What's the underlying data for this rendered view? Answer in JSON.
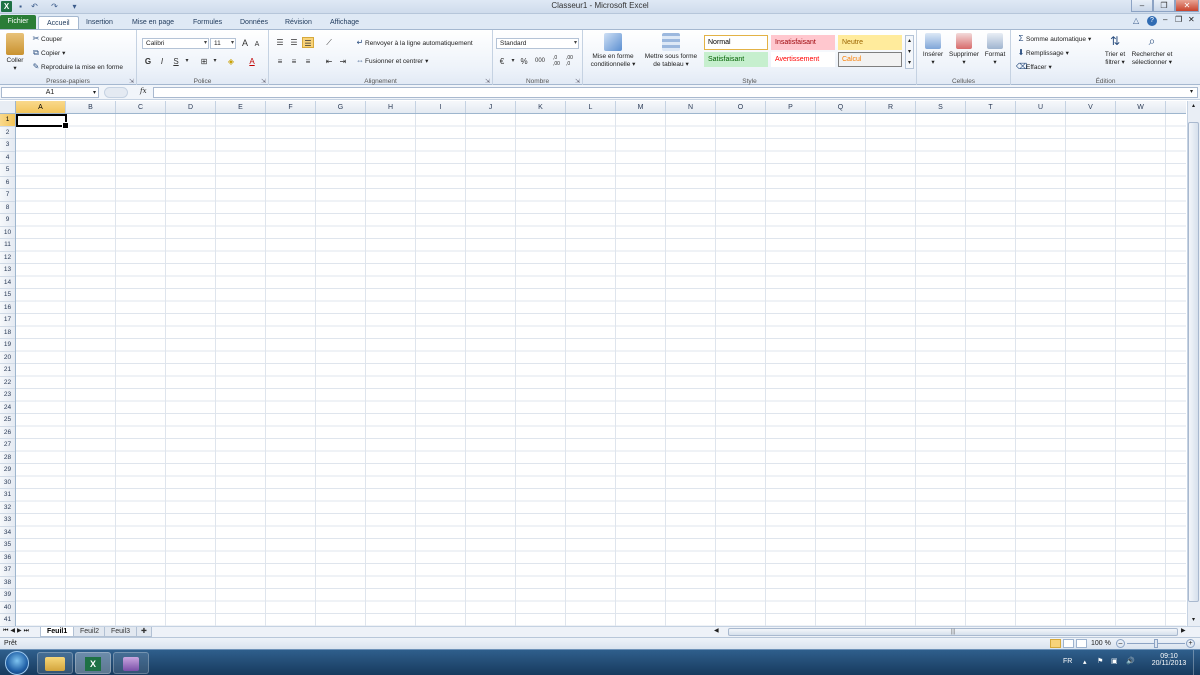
{
  "window": {
    "title": "Classeur1 - Microsoft Excel"
  },
  "quick_access": [
    "excel-logo-icon",
    "save-icon",
    "undo-icon",
    "redo-icon",
    "customize-icon"
  ],
  "tabs": {
    "file": "Fichier",
    "items": [
      "Accueil",
      "Insertion",
      "Mise en page",
      "Formules",
      "Données",
      "Révision",
      "Affichage"
    ],
    "active": "Accueil"
  },
  "ribbon": {
    "clipboard": {
      "label": "Presse-papiers",
      "paste": "Coller",
      "cut": "Couper",
      "copy": "Copier",
      "format_painter": "Reproduire la mise en forme"
    },
    "font": {
      "label": "Police",
      "font_name": "Calibri",
      "font_size": "11",
      "bold": "G",
      "italic": "I",
      "underline": "S",
      "grow": "A",
      "shrink": "A"
    },
    "alignment": {
      "label": "Alignement",
      "wrap": "Renvoyer à la ligne automatiquement",
      "merge": "Fusionner et centrer"
    },
    "number": {
      "label": "Nombre",
      "format": "Standard",
      "percent": "%",
      "thousands": "000",
      "inc_dec": ",0 ,00",
      "dec_dec": ",00 ,0"
    },
    "style": {
      "label": "Style",
      "cond_format": [
        "Mise en forme",
        "conditionnelle"
      ],
      "table_format": [
        "Mettre sous forme",
        "de tableau"
      ],
      "cells": [
        {
          "name": "Normal",
          "bg": "#ffffff",
          "fg": "#000000"
        },
        {
          "name": "Insatisfaisant",
          "bg": "#ffc7ce",
          "fg": "#9c0006"
        },
        {
          "name": "Neutre",
          "bg": "#ffeb9c",
          "fg": "#9c6500"
        },
        {
          "name": "Satisfaisant",
          "bg": "#c6efce",
          "fg": "#006100"
        },
        {
          "name": "Avertissement",
          "bg": "#ffffff",
          "fg": "#ff0000"
        },
        {
          "name": "Calcul",
          "bg": "#f2f2f2",
          "fg": "#fa7d00"
        }
      ]
    },
    "cells": {
      "label": "Cellules",
      "insert": "Insérer",
      "delete": "Supprimer",
      "format": "Format"
    },
    "editing": {
      "label": "Édition",
      "autosum": "Somme automatique",
      "fill": "Remplissage",
      "clear": "Effacer",
      "sort": [
        "Trier et",
        "filtrer"
      ],
      "find": [
        "Rechercher et",
        "sélectionner"
      ]
    }
  },
  "formula_bar": {
    "name_box": "A1",
    "fx": "fx",
    "formula": ""
  },
  "columns": [
    "A",
    "B",
    "C",
    "D",
    "E",
    "F",
    "G",
    "H",
    "I",
    "J",
    "K",
    "L",
    "M",
    "N",
    "O",
    "P",
    "Q",
    "R",
    "S",
    "T",
    "U",
    "V",
    "W"
  ],
  "row_count": 41,
  "selected_cell": {
    "col": "A",
    "row": 1
  },
  "sheets": {
    "items": [
      "Feuil1",
      "Feuil2",
      "Feuil3"
    ],
    "active": "Feuil1"
  },
  "status": {
    "mode": "Prêt",
    "zoom": "100 %"
  },
  "taskbar": {
    "lang": "FR",
    "time": "09:10",
    "date": "20/11/2013"
  }
}
